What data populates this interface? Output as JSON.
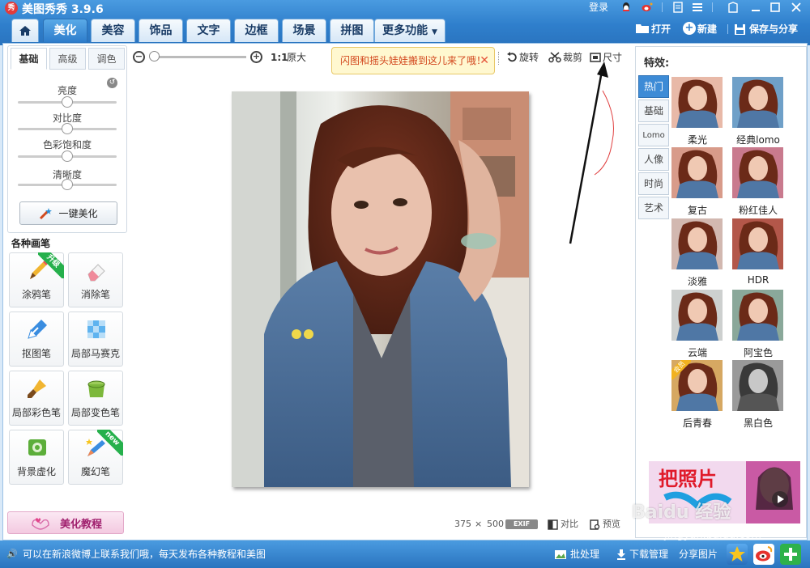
{
  "app": {
    "title": "美图秀秀 3.9.6",
    "logo_text": "秀"
  },
  "topbar": {
    "login": "登录"
  },
  "tabs": [
    "美化",
    "美容",
    "饰品",
    "文字",
    "边框",
    "场景",
    "拼图",
    "更多功能"
  ],
  "right_actions": {
    "open": "打开",
    "new": "新建",
    "save_share": "保存与分享"
  },
  "left_panel": {
    "subtabs": [
      "基础",
      "高级",
      "调色"
    ],
    "sliders": [
      {
        "label": "亮度",
        "value": 0.5
      },
      {
        "label": "对比度",
        "value": 0.5
      },
      {
        "label": "色彩饱和度",
        "value": 0.5
      },
      {
        "label": "清晰度",
        "value": 0.5
      }
    ],
    "one_key": "一键美化",
    "brush_heading": "各种画笔",
    "brushes": [
      {
        "label": "涂鸦笔",
        "badge": "升级"
      },
      {
        "label": "消除笔",
        "badge": ""
      },
      {
        "label": "抠图笔",
        "badge": ""
      },
      {
        "label": "局部马赛克",
        "badge": ""
      },
      {
        "label": "局部彩色笔",
        "badge": ""
      },
      {
        "label": "局部变色笔",
        "badge": ""
      },
      {
        "label": "背景虚化",
        "badge": ""
      },
      {
        "label": "魔幻笔",
        "badge": "new"
      }
    ],
    "tutorial": "美化教程"
  },
  "toolbar": {
    "ratio": "1:1",
    "original": "原大",
    "bubble": "闪图和摇头娃娃搬到这儿来了哦！",
    "rotate": "旋转",
    "crop": "裁剪",
    "size": "尺寸",
    "zoom_level": 0.0
  },
  "image_info": {
    "width": "375",
    "times": "×",
    "height": "500",
    "exif": "EXIF",
    "compare": "对比",
    "preview": "预览"
  },
  "right_panel": {
    "title": "特效:",
    "categories": [
      "热门",
      "基础",
      "Lomo",
      "人像",
      "时尚",
      "艺术"
    ],
    "effects": [
      {
        "label": "柔光",
        "badge": ""
      },
      {
        "label": "经典lomo",
        "badge": ""
      },
      {
        "label": "复古",
        "badge": ""
      },
      {
        "label": "粉红佳人",
        "badge": ""
      },
      {
        "label": "淡雅",
        "badge": ""
      },
      {
        "label": "HDR",
        "badge": ""
      },
      {
        "label": "云端",
        "badge": ""
      },
      {
        "label": "阿宝色",
        "badge": ""
      },
      {
        "label": "后青春",
        "badge": "会员"
      },
      {
        "label": "黑白色",
        "badge": ""
      }
    ],
    "ad_text": "把照片"
  },
  "statusbar": {
    "message": "可以在新浪微博上联系我们哦，每天发布各种教程和美图",
    "batch": "批处理",
    "download": "下载管理",
    "share": "分享图片"
  },
  "watermark": {
    "line1": "Baidu 经验",
    "line2": "jingyan.baidu.com"
  },
  "colors": {
    "accent": "#2f7fcc",
    "bubble_text": "#d2461c"
  }
}
